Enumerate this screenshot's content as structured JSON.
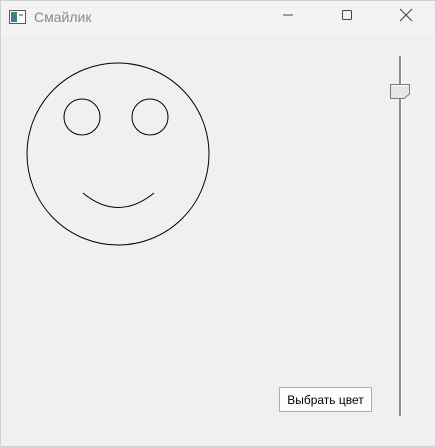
{
  "window": {
    "title": "Смайлик",
    "icon": "app-window-icon",
    "controls": {
      "minimize_icon": "minimize-icon",
      "maximize_icon": "maximize-icon",
      "close_icon": "close-icon"
    }
  },
  "canvas": {
    "drawing": "smiley-face",
    "stroke_color": "#000000"
  },
  "slider": {
    "orientation": "vertical",
    "level": 0.08
  },
  "buttons": {
    "choose_color_label": "Выбрать цвет"
  },
  "colors": {
    "background": "#f0f0f0",
    "titlebar": "#f3f3f3",
    "title_text": "#8a8a8a"
  }
}
